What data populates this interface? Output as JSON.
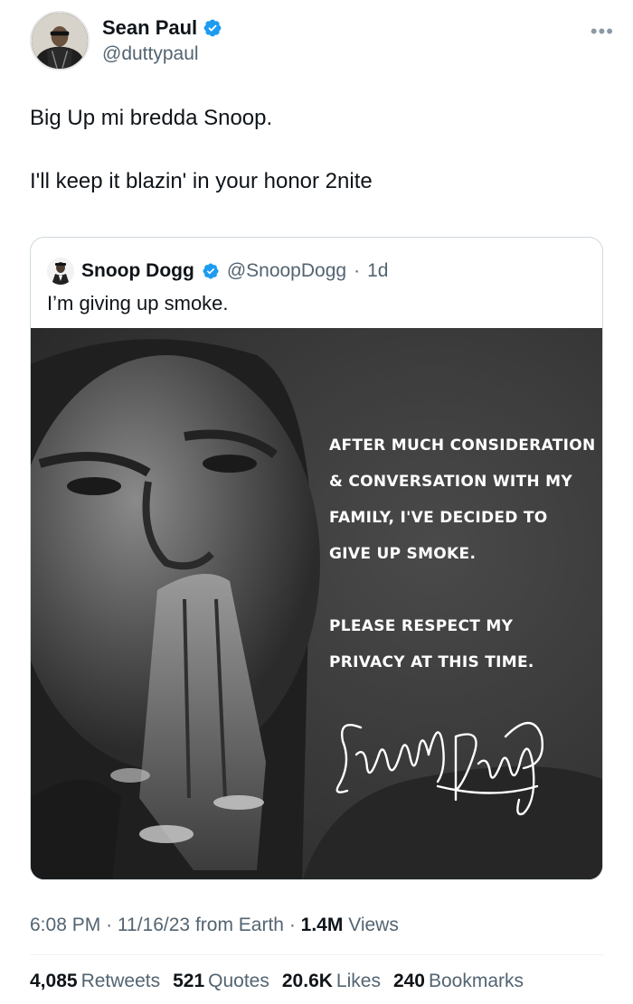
{
  "author": {
    "name": "Sean Paul",
    "handle": "@duttypaul"
  },
  "tweet": {
    "line1": "Big Up mi bredda Snoop.",
    "line2": "I'll keep it blazin' in your honor 2nite"
  },
  "quoted": {
    "name": "Snoop Dogg",
    "handle": "@SnoopDogg",
    "separator": "·",
    "age": "1d",
    "text": "I’m giving up smoke.",
    "image_text": {
      "lines1": [
        "After much consideration",
        "& conversation with my",
        "family, I've decided to",
        "give up smoke."
      ],
      "lines2": [
        "Please respect my",
        "privacy at this time."
      ]
    }
  },
  "meta": {
    "time": "6:08 PM",
    "sep1": "·",
    "date": "11/16/23",
    "location": "from Earth",
    "sep2": "·",
    "views_count": "1.4M",
    "views_label": "Views"
  },
  "stats": [
    {
      "count": "4,085",
      "label": "Retweets"
    },
    {
      "count": "521",
      "label": "Quotes"
    },
    {
      "count": "20.6K",
      "label": "Likes"
    },
    {
      "count": "240",
      "label": "Bookmarks"
    }
  ],
  "colors": {
    "verified": "#1d9bf0",
    "secondary_text": "#536471",
    "primary_text": "#0f1419"
  },
  "icons": {
    "verified": "verified-badge-icon",
    "more": "more-horizontal-icon"
  }
}
